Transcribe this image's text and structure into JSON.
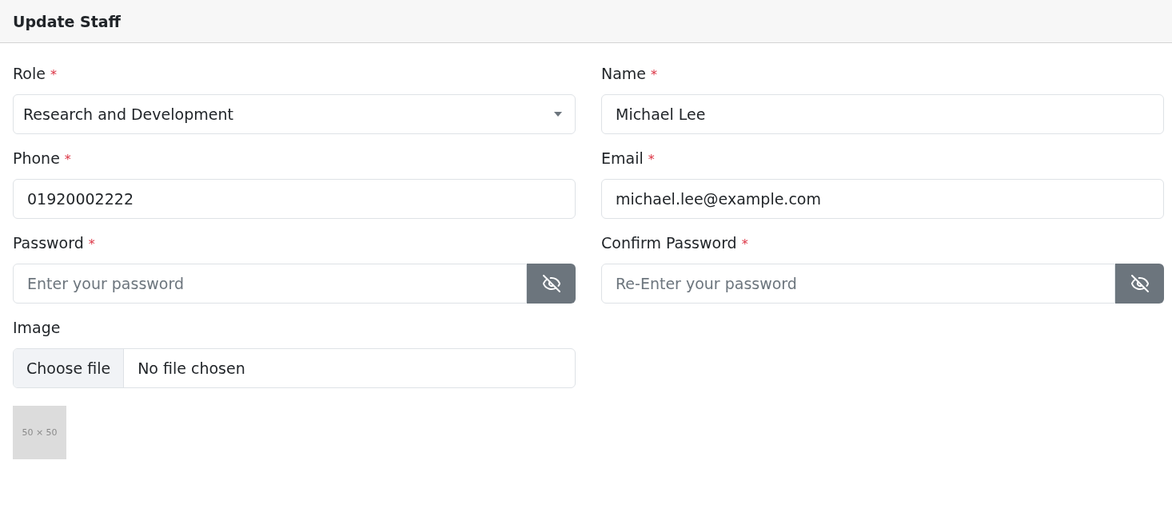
{
  "header": {
    "title": "Update Staff"
  },
  "fields": [
    {
      "kind": "select",
      "label": "Role",
      "required_mark": "*",
      "value": "Research and Development"
    },
    {
      "kind": "text",
      "label": "Name",
      "required_mark": "*",
      "value": "Michael Lee"
    },
    {
      "kind": "text",
      "label": "Phone",
      "required_mark": "*",
      "value": "01920002222"
    },
    {
      "kind": "text",
      "label": "Email",
      "required_mark": "*",
      "value": "michael.lee@example.com"
    },
    {
      "kind": "password",
      "label": "Password",
      "required_mark": "*",
      "placeholder": "Enter your password"
    },
    {
      "kind": "password",
      "label": "Confirm Password",
      "required_mark": "*",
      "placeholder": "Re-Enter your password"
    },
    {
      "kind": "file",
      "label": "Image",
      "button": "Choose file",
      "status": "No file chosen"
    }
  ],
  "image_preview": {
    "text": "50 × 50"
  }
}
